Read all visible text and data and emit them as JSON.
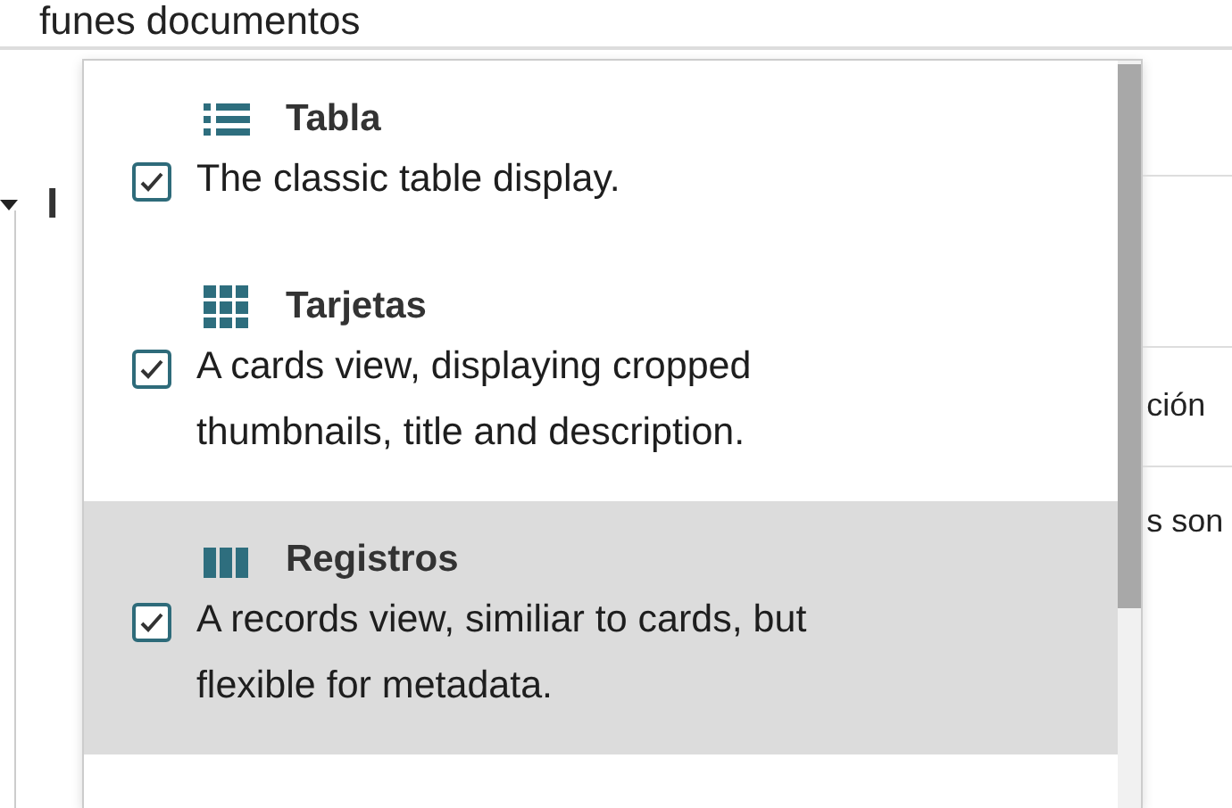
{
  "page": {
    "title": "funes documentos",
    "heading": "I",
    "cells": [
      "ción",
      "s son"
    ]
  },
  "views_menu": {
    "items": [
      {
        "kind": "table",
        "title": "Tabla",
        "description": "The classic table display.",
        "checked": true,
        "selected": false
      },
      {
        "kind": "cards",
        "title": "Tarjetas",
        "description": "A cards view, displaying cropped thumbnails, title and description.",
        "checked": true,
        "selected": false
      },
      {
        "kind": "records",
        "title": "Registros",
        "description": "A records view, similiar to cards, but flexible for metadata.",
        "checked": true,
        "selected": true
      }
    ]
  }
}
